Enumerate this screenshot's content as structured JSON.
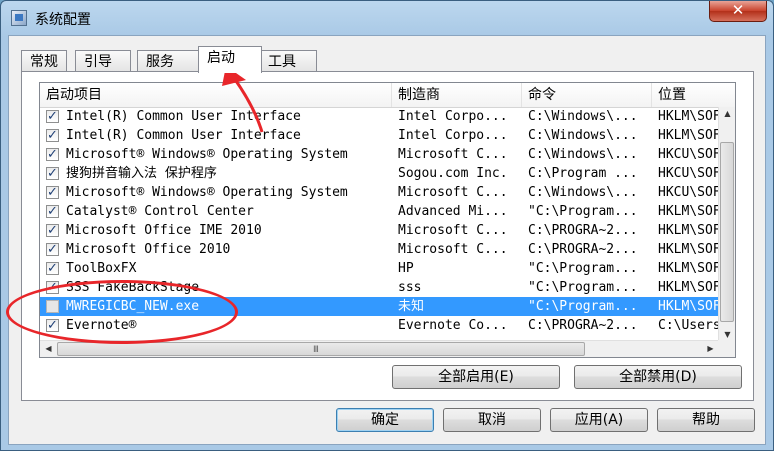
{
  "window": {
    "title": "系统配置",
    "close_label": "✕"
  },
  "tabs": [
    {
      "label": "常规"
    },
    {
      "label": "引导"
    },
    {
      "label": "服务"
    },
    {
      "label": "启动"
    },
    {
      "label": "工具"
    }
  ],
  "columns": [
    "启动项目",
    "制造商",
    "命令",
    "位置"
  ],
  "rows": [
    {
      "name": "Intel(R) Common User Interface",
      "maker": "Intel Corpo...",
      "command": "C:\\Windows\\...",
      "location": "HKLM\\SOFT",
      "checked": true
    },
    {
      "name": "Intel(R) Common User Interface",
      "maker": "Intel Corpo...",
      "command": "C:\\Windows\\...",
      "location": "HKLM\\SOFT",
      "checked": true
    },
    {
      "name": "Microsoft® Windows® Operating System",
      "maker": "Microsoft C...",
      "command": "C:\\Windows\\...",
      "location": "HKCU\\SOFT",
      "checked": true
    },
    {
      "name": "搜狗拼音输入法 保护程序",
      "maker": "Sogou.com Inc.",
      "command": "C:\\Program ...",
      "location": "HKCU\\SOFT",
      "checked": true
    },
    {
      "name": "Microsoft® Windows® Operating System",
      "maker": "Microsoft C...",
      "command": "C:\\Windows\\...",
      "location": "HKCU\\SOFT",
      "checked": true
    },
    {
      "name": "Catalyst® Control Center",
      "maker": "Advanced Mi...",
      "command": "\"C:\\Program...",
      "location": "HKLM\\SOFT",
      "checked": true
    },
    {
      "name": "Microsoft Office IME 2010",
      "maker": "Microsoft C...",
      "command": "C:\\PROGRA~2...",
      "location": "HKLM\\SOFT",
      "checked": true
    },
    {
      "name": "Microsoft Office 2010",
      "maker": "Microsoft C...",
      "command": "C:\\PROGRA~2...",
      "location": "HKLM\\SOFT",
      "checked": true
    },
    {
      "name": "ToolBoxFX",
      "maker": "HP",
      "command": "\"C:\\Program...",
      "location": "HKLM\\SOFT",
      "checked": true
    },
    {
      "name": "SSS FakeBackStage",
      "maker": "sss",
      "command": "\"C:\\Program...",
      "location": "HKLM\\SOFT",
      "checked": true
    },
    {
      "name": "MWREGICBC_NEW.exe",
      "maker": "未知",
      "command": "\"C:\\Program...",
      "location": "HKLM\\SOFT",
      "checked": false,
      "selected": true
    },
    {
      "name": "Evernote®",
      "maker": "Evernote Co...",
      "command": "C:\\PROGRA~2...",
      "location": "C:\\Users\\",
      "checked": true
    }
  ],
  "scroll": {
    "grip": "III"
  },
  "panel_buttons": {
    "enable_all": "全部启用(E)",
    "disable_all": "全部禁用(D)"
  },
  "dialog_buttons": {
    "ok": "确定",
    "cancel": "取消",
    "apply": "应用(A)",
    "help": "帮助"
  },
  "colors": {
    "selection": "#3399ff",
    "annotation": "#e8262a"
  }
}
